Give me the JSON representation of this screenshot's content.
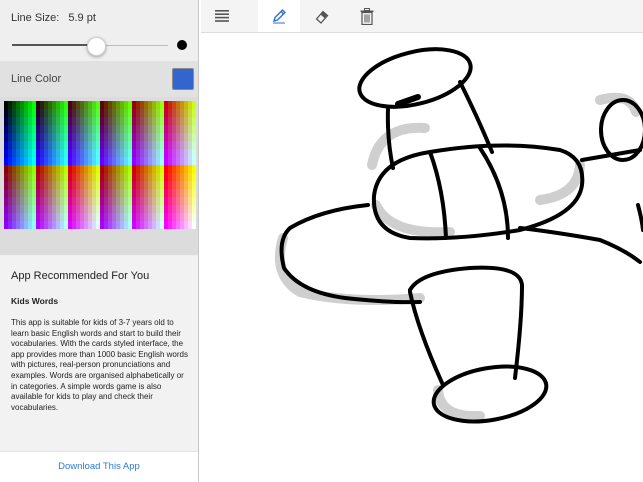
{
  "settings": {
    "line_size_label": "Line Size:",
    "line_size_value": "5.9 pt",
    "line_size_slider_fraction": 0.54,
    "line_color_label": "Line Color",
    "line_color": "#3366cc"
  },
  "recommend": {
    "title": "App Recommended For You",
    "app_name": "Kids Words",
    "description": "This app is suitable for kids of 3-7 years old to learn basic English words and start to build their vocabularies. With the cards styled interface, the app provides more than 1000 basic English words with pictures, real-person pronunciations and examples. Words are organised alphabetically or in categories. A simple words game is also available for kids to play and check their vocabularies.",
    "download_label": "Download This App"
  },
  "toolbar": {
    "tools": [
      {
        "name": "menu",
        "icon": "menu-icon",
        "active": false
      },
      {
        "name": "pencil",
        "icon": "pencil-icon",
        "active": true
      },
      {
        "name": "eraser",
        "icon": "eraser-icon",
        "active": false
      },
      {
        "name": "trash",
        "icon": "trash-icon",
        "active": false
      }
    ]
  },
  "colors": {
    "accent": "#2e7bd6",
    "stroke": "#000000",
    "shadow": "#c8c8c8"
  }
}
